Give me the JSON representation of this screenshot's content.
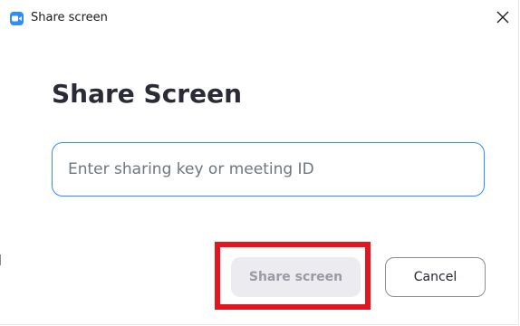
{
  "window": {
    "title": "Share screen",
    "close_glyph": "✕"
  },
  "dialog": {
    "heading": "Share Screen",
    "input": {
      "value": "",
      "placeholder": "Enter sharing key or meeting ID"
    },
    "buttons": {
      "share_label": "Share screen",
      "cancel_label": "Cancel"
    }
  },
  "icons": {
    "app": "zoom-camera-icon",
    "close": "close-icon"
  },
  "colors": {
    "accent": "#2d8cff",
    "highlight": "#e4151f",
    "disabled_button_bg": "#ececf0",
    "disabled_button_text": "#9a9aa3",
    "heading_text": "#2b2b37"
  }
}
